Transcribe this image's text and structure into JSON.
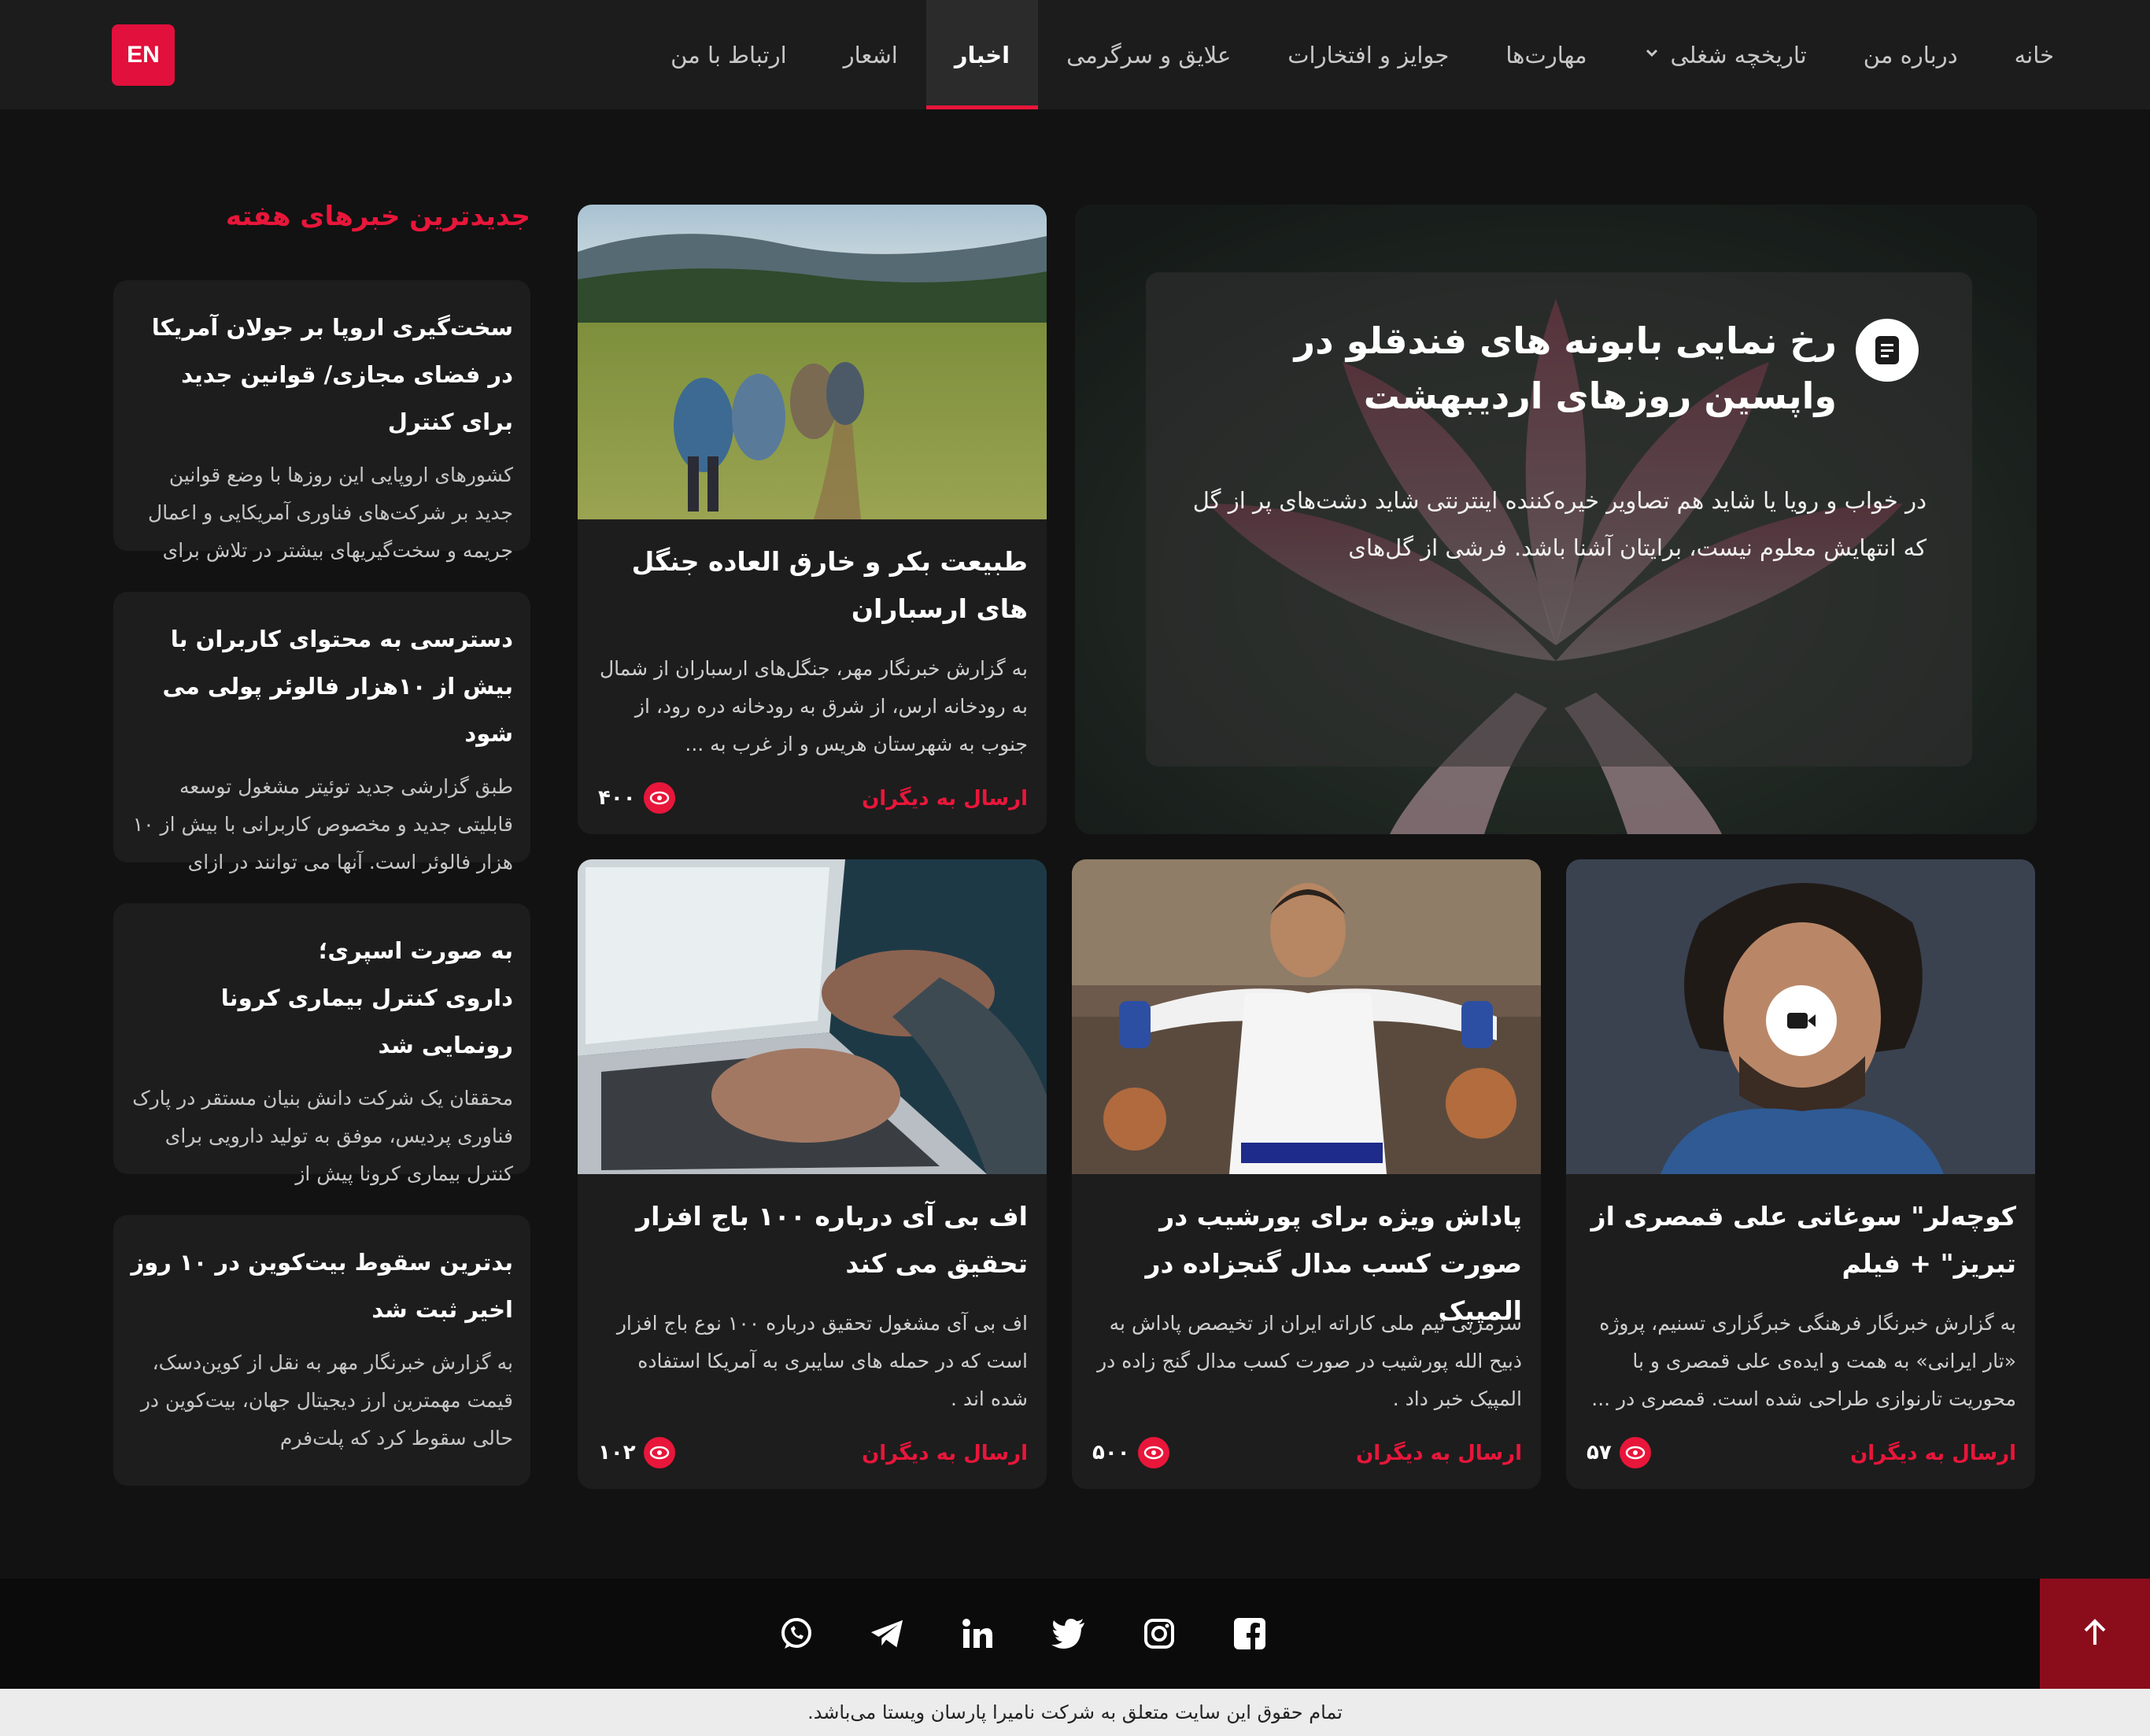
{
  "nav": {
    "items": [
      {
        "label": "خانه",
        "active": false
      },
      {
        "label": "درباره من",
        "active": false
      },
      {
        "label": "تاریخچه شغلی",
        "active": false,
        "dropdown": true
      },
      {
        "label": "مهارت‌ها",
        "active": false
      },
      {
        "label": "جوایز و افتخارات",
        "active": false
      },
      {
        "label": "علایق و سرگرمی",
        "active": false
      },
      {
        "label": "اخبار",
        "active": true
      },
      {
        "label": "اشعار",
        "active": false
      },
      {
        "label": "ارتباط با من",
        "active": false
      }
    ],
    "lang_button": "EN",
    "accent": "#e8163a"
  },
  "sidebar": {
    "title": "جدیدترین خبرهای هفته",
    "items": [
      {
        "title": "سخت‌گیری اروپا بر جولان آمریکا در فضای مجازی/ قوانین جدید برای کنترل",
        "excerpt": "کشورهای اروپایی این روزها با وضع قوانین جدید بر شرکت‌های فناوری آمریکایی و اعمال جریمه و سخت‌گیریهای بیشتر در تلاش برای"
      },
      {
        "title": "دسترسی به محتوای کاربران با بیش از ۱۰هزار فالوئر پولی می شود",
        "excerpt": "طبق گزارشی جدید توئیتر مشغول توسعه قابلیتی جدید و مخصوص کاربرانی با بیش از ۱۰ هزار فالوئر است. آنها می توانند در ازای"
      },
      {
        "title_line1": "به صورت اسپری؛",
        "title_line2": "داروی کنترل بیماری کرونا رونمایی شد",
        "excerpt": "محققان یک شرکت دانش بنیان مستقر در پارک فناوری پردیس، موفق به تولید دارویی برای کنترل بیماری کرونا پیش از"
      },
      {
        "title": "بدترین سقوط بیت‌کوین در ۱۰ روز اخیر ثبت شد",
        "excerpt": "به گزارش خبرنگار مهر به نقل از کوین‌دسک، قیمت مهمترین ارز دیجیتال جهان، بیت‌کوین در حالی سقوط کرد که پلت‌فرم"
      }
    ]
  },
  "featured": {
    "icon": "document-icon",
    "title": "رخ نمایی بابونه های فندقلو در واپسین روزهای اردیبهشت",
    "description": "در خواب و رویا یا شاید هم تصاویر خیره‌کننده اینترنتی شاید دشت‌های پر از گل که انتهایش معلوم نیست، برایتان آشنا باشد. فرشی از گل‌های"
  },
  "cards": [
    {
      "id": "forest",
      "title": "طبیعت بکر و خارق العاده جنگل های ارسباران",
      "excerpt": "به گزارش خبرنگار مهر، جنگل‌های ارسباران از شمال به رودخانه ارس، از شرق به رودخانه دره رود، از جنوب به شهرستان هریس و از غرب به ...",
      "share": "ارسال به دیگران",
      "views": "۴۰۰"
    },
    {
      "id": "fbi",
      "title": "اف بی آی درباره ۱۰۰ باج افزار تحقیق می کند",
      "excerpt": "اف بی آی مشغول تحقیق درباره ۱۰۰ نوع باج افزار است که در حمله های سایبری به آمریکا استفاده شده اند .",
      "share": "ارسال به دیگران",
      "views": "۱۰۲"
    },
    {
      "id": "karate",
      "title": "پاداش ویژه برای پورشیب در صورت کسب مدال گنجزاده در المپیک",
      "excerpt": "سرمربی تیم ملی کاراته ایران از تخیصص پاداش به ذبیح الله پورشیب در صورت کسب مدال گنج زاده در المپیک خبر داد .",
      "share": "ارسال به دیگران",
      "views": "۵۰۰"
    },
    {
      "id": "music",
      "title": "کوچه‌لر\" سوغاتی علی قمصری از تبریز\" + فیلم",
      "excerpt": "به گزارش خبرنگار فرهنگی خبرگزاری تسنیم، پروژه «تار ایرانی» به همت و ایده‌ی علی قمصری و با محوریت تارنوازی طراحی شده است. قمصری در ...",
      "share": "ارسال به دیگران",
      "views": "۵۷",
      "badge": "video-icon"
    }
  ],
  "footer": {
    "socials": [
      "whatsapp-icon",
      "telegram-icon",
      "linkedin-icon",
      "twitter-icon",
      "instagram-icon",
      "facebook-icon"
    ],
    "back_to_top_icon": "arrow-up-icon",
    "copyright": "تمام حقوق این سایت متعلق به شرکت نامیرا پارسان ویستا می‌باشد."
  }
}
